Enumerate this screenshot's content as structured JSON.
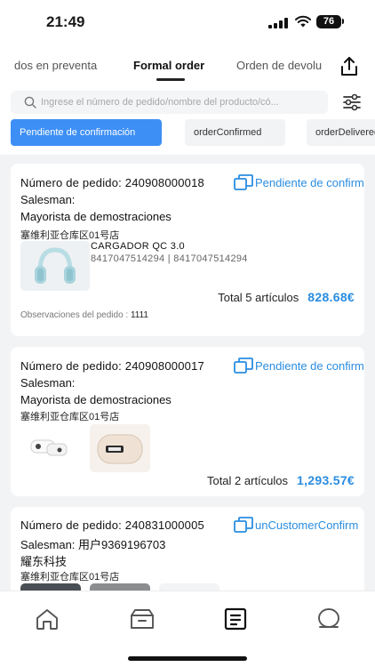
{
  "status_bar": {
    "time": "21:49",
    "battery": "76"
  },
  "tabs": [
    {
      "label": "dos en preventa",
      "active": false
    },
    {
      "label": "Formal order",
      "active": true
    },
    {
      "label": "Orden de devolu",
      "active": false
    }
  ],
  "search": {
    "placeholder": "Ingrese el número de pedido/nombre del producto/có..."
  },
  "filters": [
    {
      "label": "Pendiente de confirmación",
      "active": true
    },
    {
      "label": "orderConfirmed",
      "active": false
    },
    {
      "label": "orderDelivered",
      "active": false
    }
  ],
  "orders": [
    {
      "number": "Número de pedido: 240908000018",
      "status": "Pendiente de confirmación",
      "salesman": "Salesman:",
      "customer": "Mayorista de demostraciones",
      "warehouse": "塞维利亚仓库区01号店",
      "product_name": "CARGADOR QC 3.0",
      "product_code": "8417047514294  |  8417047514294",
      "total_label": "Total 5 artículos",
      "total_amount": "828.68€",
      "remarks_label": "Observaciones del pedido :",
      "remarks_value": "1111"
    },
    {
      "number": "Número de pedido: 240908000017",
      "status": "Pendiente de confirmación",
      "salesman": "Salesman:",
      "customer": "Mayorista de demostraciones",
      "warehouse": "塞维利亚仓库区01号店",
      "total_label": "Total 2 artículos",
      "total_amount": "1,293.57€"
    },
    {
      "number": "Número de pedido: 240831000005",
      "status": "unCustomerConfirm",
      "salesman": "Salesman: 用户9369196703",
      "customer": "耀东科技",
      "warehouse": "塞维利亚仓库区01号店"
    }
  ],
  "bottom_nav": [
    {
      "icon": "home-icon",
      "active": false
    },
    {
      "icon": "box-icon",
      "active": false
    },
    {
      "icon": "orders-icon",
      "active": true
    },
    {
      "icon": "profile-icon",
      "active": false
    }
  ],
  "colors": {
    "accent": "#3d8ff5",
    "status_text": "#2a8de0",
    "background": "#f2f3f5"
  }
}
